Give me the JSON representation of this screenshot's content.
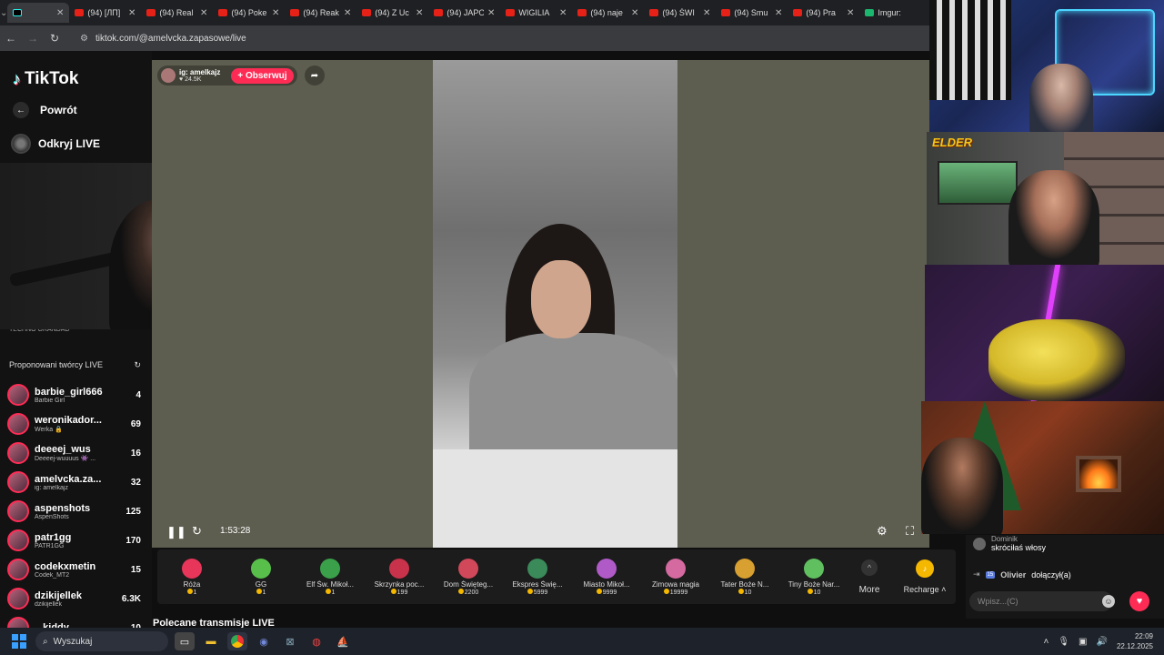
{
  "browser": {
    "tabs": [
      {
        "title": "",
        "icon": "tiktok-icon",
        "active": true
      },
      {
        "title": "(94) [ЛП]",
        "icon": "youtube-icon"
      },
      {
        "title": "(94) Real",
        "icon": "youtube-icon"
      },
      {
        "title": "(94) Poke",
        "icon": "youtube-icon"
      },
      {
        "title": "(94) Reak",
        "icon": "youtube-icon"
      },
      {
        "title": "(94) Z Uc",
        "icon": "youtube-icon"
      },
      {
        "title": "(94) JAPO",
        "icon": "youtube-icon"
      },
      {
        "title": "WIGILIA",
        "icon": "youtube-icon"
      },
      {
        "title": "(94) naje",
        "icon": "youtube-icon"
      },
      {
        "title": "(94) ŚWI",
        "icon": "youtube-icon"
      },
      {
        "title": "(94) Smu",
        "icon": "youtube-icon"
      },
      {
        "title": "(94) Pra",
        "icon": "youtube-icon"
      },
      {
        "title": "Imgur:",
        "icon": "imgur-icon"
      }
    ],
    "url": "tiktok.com/@amelvcka.zapasowe/live"
  },
  "sidebar": {
    "brand": "TikTok",
    "back_label": "Powrót",
    "discover_label": "Odkryj LIVE",
    "cut_label": "TECHNO GRANDAD",
    "suggested_title": "Proponowani twórcy LIVE",
    "creators": [
      {
        "name": "barbie_girl666",
        "sub": "Barbie Girl",
        "count": "4"
      },
      {
        "name": "weronikador...",
        "sub": "Werka 🔒",
        "count": "69"
      },
      {
        "name": "deeeej_wus",
        "sub": "Deeeej-wuuuus 👾 ...",
        "count": "16"
      },
      {
        "name": "amelvcka.za...",
        "sub": "ig: amelkajz",
        "count": "32"
      },
      {
        "name": "aspenshots",
        "sub": "AspenShots",
        "count": "125"
      },
      {
        "name": "patr1gg",
        "sub": "PATR1GG",
        "count": "170"
      },
      {
        "name": "codekxmetin",
        "sub": "Codek_MT2",
        "count": "15"
      },
      {
        "name": "dzikijellek",
        "sub": "dzikijellek",
        "count": "6.3K"
      },
      {
        "name": "...kiddy",
        "sub": "",
        "count": "10"
      }
    ]
  },
  "live": {
    "host_name": "ig: amelkajz",
    "likes": "24.5K",
    "follow_label": "+ Obserwuj",
    "duration": "1:53:28",
    "recommended_title": "Polecane transmisje LIVE"
  },
  "gifts": [
    {
      "name": "Róża",
      "price": "1",
      "color": "#e8355a"
    },
    {
      "name": "GG",
      "price": "1",
      "color": "#58c04a"
    },
    {
      "name": "Elf Św. Mikoł...",
      "price": "1",
      "color": "#3aa04a"
    },
    {
      "name": "Skrzynka poc...",
      "price": "199",
      "color": "#c8324a"
    },
    {
      "name": "Dom Święteg...",
      "price": "2200",
      "color": "#d0485a"
    },
    {
      "name": "Ekspres Świę...",
      "price": "5999",
      "color": "#3a8a5a"
    },
    {
      "name": "Miasto Mikoł...",
      "price": "9999",
      "color": "#b05ac8"
    },
    {
      "name": "Zimowa magia",
      "price": "19999",
      "color": "#d46aa0"
    },
    {
      "name": "Tater Boże N...",
      "price": "10",
      "color": "#d8a030"
    },
    {
      "name": "Tiny Boże Nar...",
      "price": "10",
      "color": "#60c060"
    }
  ],
  "gift_more_label": "More",
  "recharge_label": "Recharge",
  "chat": {
    "messages": [
      {
        "user": "Dominik",
        "text": "skróciłaś włosy"
      },
      {
        "user": "Olivier",
        "text": "dołączył(a)",
        "level": "15"
      }
    ],
    "input_placeholder": "Wpisz...(C)"
  },
  "overlay": {
    "elder_logo": "ELDER"
  },
  "taskbar": {
    "search_label": "Wyszukaj",
    "time": "22:09",
    "date": "22.12.2025"
  }
}
